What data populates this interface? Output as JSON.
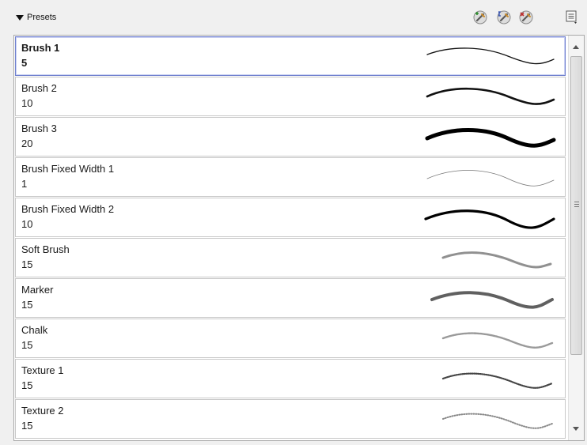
{
  "header": {
    "title": "Presets",
    "toggle_icon": "triangle-down-icon",
    "tools": [
      "add-preset-icon",
      "rename-preset-icon",
      "delete-preset-icon"
    ],
    "menu_icon": "panel-menu-icon"
  },
  "presets": [
    {
      "name": "Brush 1",
      "size": "5",
      "stroke_style": "thin-brush",
      "selected": true
    },
    {
      "name": "Brush 2",
      "size": "10",
      "stroke_style": "medium-brush"
    },
    {
      "name": "Brush 3",
      "size": "20",
      "stroke_style": "thick-brush"
    },
    {
      "name": "Brush Fixed Width 1",
      "size": "1",
      "stroke_style": "hairline"
    },
    {
      "name": "Brush Fixed Width 2",
      "size": "10",
      "stroke_style": "fixed-thick"
    },
    {
      "name": "Soft Brush",
      "size": "15",
      "stroke_style": "soft"
    },
    {
      "name": "Marker",
      "size": "15",
      "stroke_style": "marker"
    },
    {
      "name": "Chalk",
      "size": "15",
      "stroke_style": "chalk"
    },
    {
      "name": "Texture 1",
      "size": "15",
      "stroke_style": "texture-1"
    },
    {
      "name": "Texture 2",
      "size": "15",
      "stroke_style": "texture-2"
    }
  ],
  "colors": {
    "selection_border": "#6f7fce",
    "row_border": "#c8c8c8",
    "background": "#f0f0f0"
  }
}
